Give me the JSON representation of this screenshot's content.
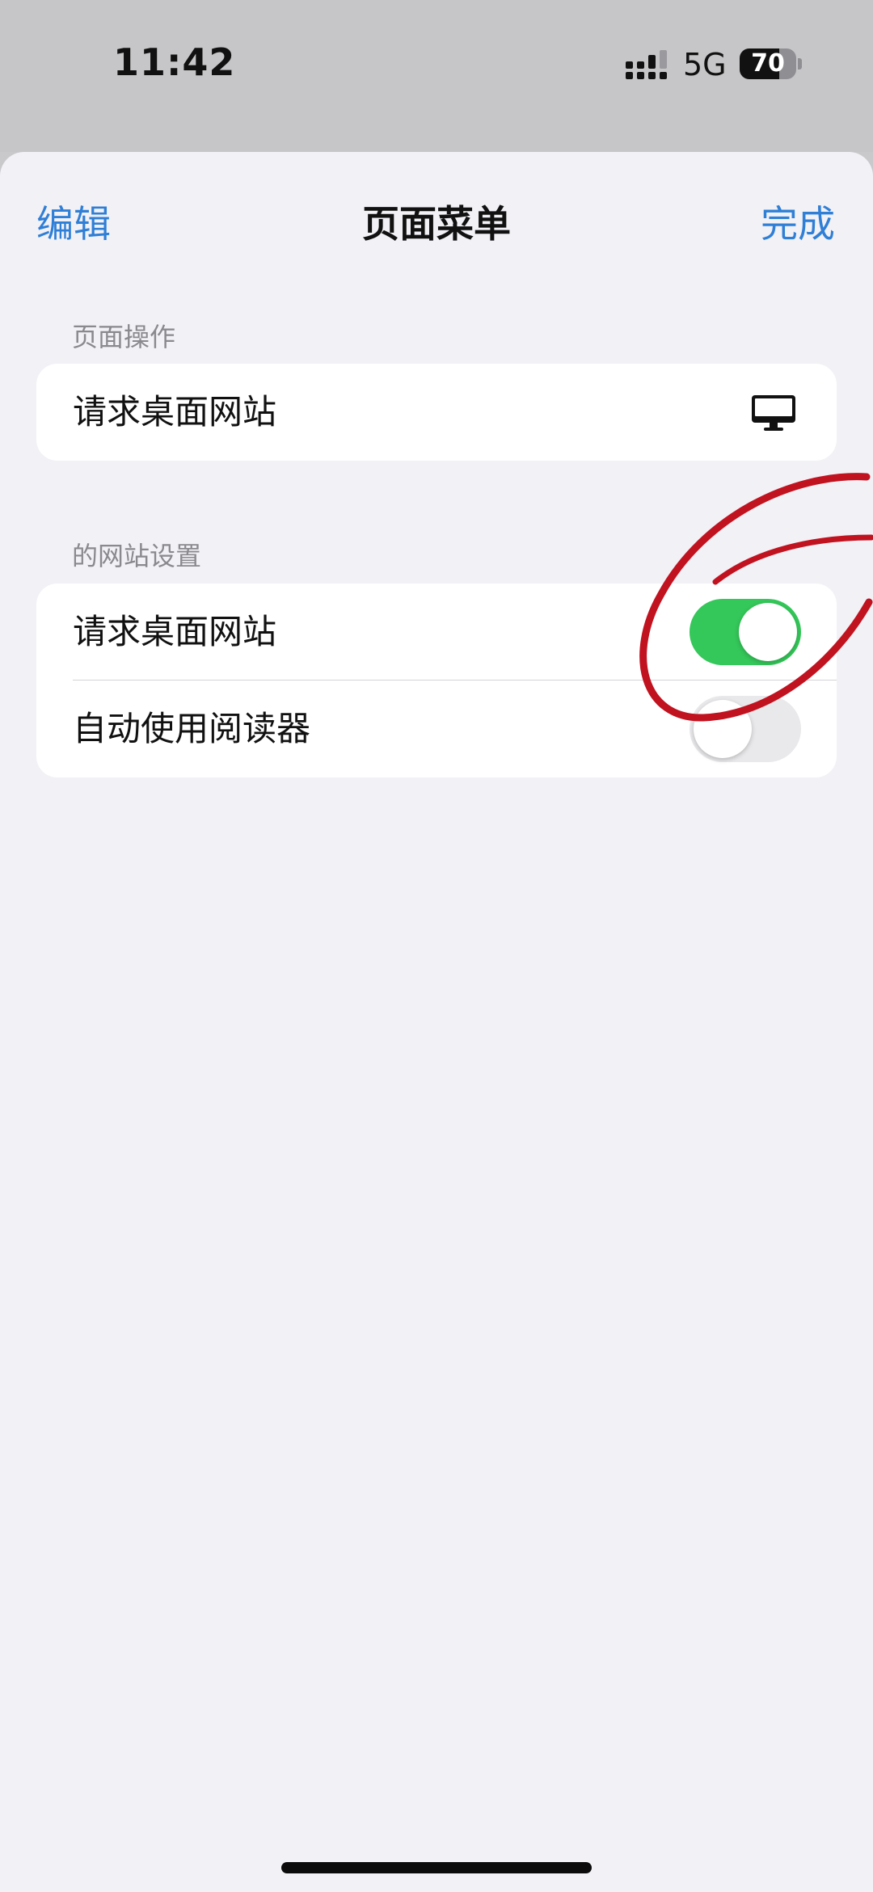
{
  "status_bar": {
    "time": "11:42",
    "network": "5G",
    "battery_percent": "70",
    "battery_level": 0.7
  },
  "sheet": {
    "edit_label": "编辑",
    "title": "页面菜单",
    "done_label": "完成",
    "accent_color": "#2f7fd6"
  },
  "page_actions": {
    "header": "页面操作",
    "items": [
      {
        "label": "请求桌面网站",
        "icon": "desktop-computer-icon"
      }
    ]
  },
  "site_settings": {
    "header": "的网站设置",
    "items": [
      {
        "label": "请求桌面网站",
        "toggle": true
      },
      {
        "label": "自动使用阅读器",
        "toggle": false
      }
    ],
    "toggle_on_color": "#34c759"
  },
  "annotation": {
    "type": "hand-drawn-circle",
    "color": "#c1121f"
  }
}
